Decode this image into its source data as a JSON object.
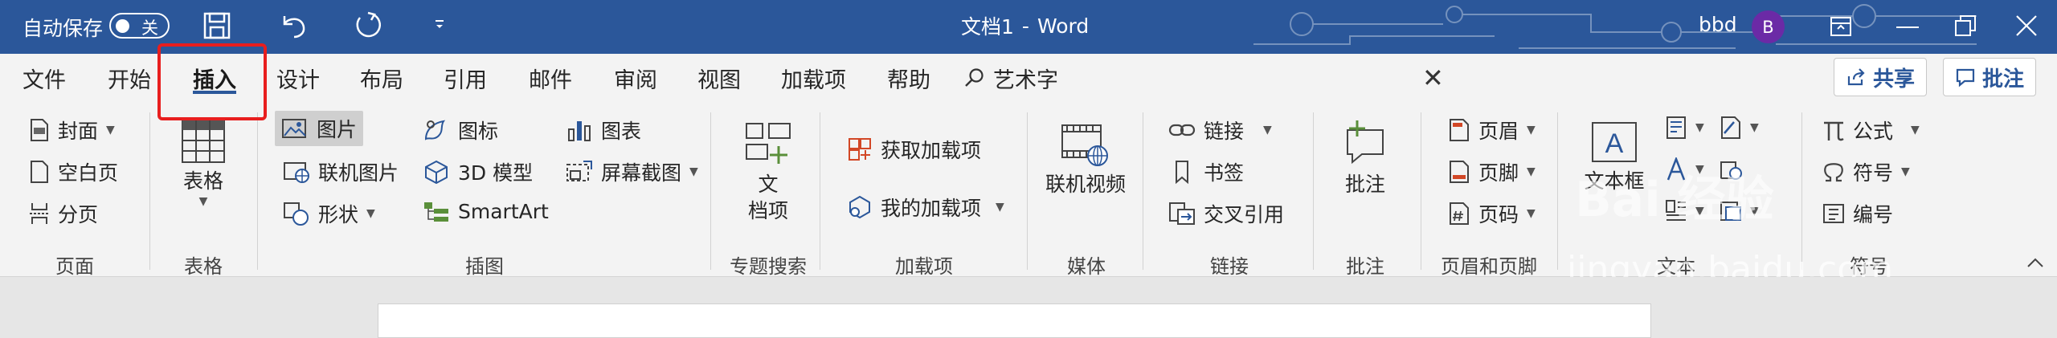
{
  "titlebar": {
    "autosave_label": "自动保存",
    "autosave_state": "关",
    "document_title": "文档1",
    "title_separator": "-",
    "app_name": "Word",
    "user_name": "bbd",
    "avatar_initial": "B",
    "bg_color": "#2b579a"
  },
  "tabs": [
    "文件",
    "开始",
    "插入",
    "设计",
    "布局",
    "引用",
    "邮件",
    "审阅",
    "视图",
    "加载项",
    "帮助"
  ],
  "tell_me": "艺术字",
  "share_label": "共享",
  "comments_label": "批注",
  "groups": {
    "pages": {
      "label": "页面",
      "items": [
        "封面",
        "空白页",
        "分页"
      ]
    },
    "tables": {
      "label": "表格",
      "item": "表格"
    },
    "illustrations": {
      "label": "插图",
      "items": [
        "图片",
        "联机图片",
        "形状",
        "图标",
        "3D 模型",
        "SmartArt",
        "图表",
        "屏幕截图"
      ]
    },
    "topic_search": {
      "label": "专题搜索",
      "item_line1": "文",
      "item_line2": "档项"
    },
    "addins": {
      "label": "加载项",
      "items": [
        "获取加载项",
        "我的加载项"
      ]
    },
    "media": {
      "label": "媒体",
      "item": "联机视频"
    },
    "links": {
      "label": "链接",
      "items": [
        "链接",
        "书签",
        "交叉引用"
      ]
    },
    "comments": {
      "label": "批注",
      "item": "批注"
    },
    "header_footer": {
      "label": "页眉和页脚",
      "items": [
        "页眉",
        "页脚",
        "页码"
      ]
    },
    "text": {
      "label": "文本",
      "item": "文本框"
    },
    "symbols": {
      "label": "符号",
      "items": [
        "公式",
        "符号",
        "编号"
      ]
    }
  },
  "watermark": {
    "line1": "Bai 经验",
    "line2": "jingyan.baidu.com"
  }
}
